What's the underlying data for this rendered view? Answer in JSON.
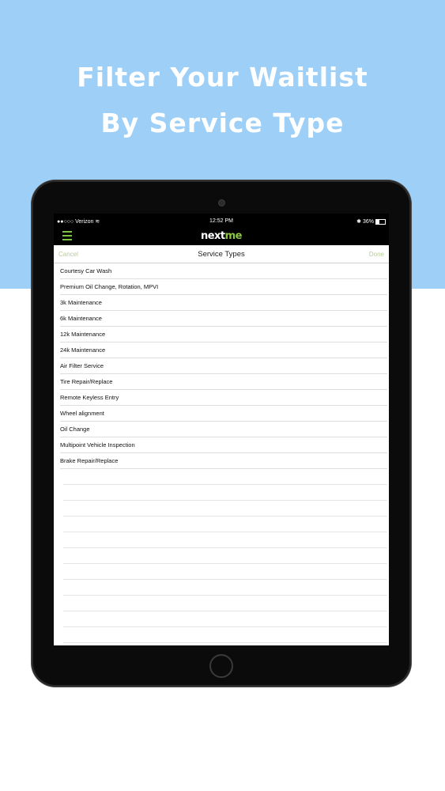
{
  "headline": {
    "line1": "Filter Your Waitlist",
    "line2": "By Service Type"
  },
  "status_bar": {
    "carrier": "●●○○○ Verizon ≋",
    "time": "12:52 PM",
    "battery": "✱ 36%"
  },
  "app": {
    "menu_icon": "hamburger-menu-icon",
    "logo_part1": "next",
    "logo_part2": "me"
  },
  "sheet": {
    "cancel_label": "Cancel",
    "title": "Service Types",
    "done_label": "Done",
    "items": [
      "Courtesy Car Wash",
      "Premium Oil Change, Rotation, MPVI",
      "3k Maintenance",
      "6k Maintenance",
      "12k Maintenance",
      "24k Maintenance",
      "Air Filter Service",
      "Tire Repair/Replace",
      "Remote Keyless Entry",
      "Wheel alignment",
      "Oil Change",
      "Multipoint Vehicle Inspection",
      "Brake Repair/Replace"
    ]
  },
  "colors": {
    "background_top": "#9dcff7",
    "accent_green": "#8cc63f",
    "muted_green": "#b7cc97"
  }
}
